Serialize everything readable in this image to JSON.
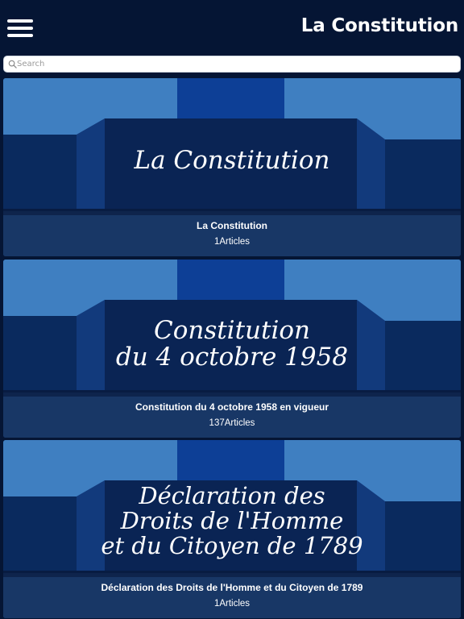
{
  "header": {
    "title": "La Constitution",
    "menu_icon": "hamburger-menu-icon"
  },
  "search": {
    "placeholder": "Search",
    "value": "",
    "icon": "search-icon"
  },
  "colors": {
    "header_bg": "#051534",
    "banner_light": "#3f7fc1",
    "banner_center": "#0a2a62",
    "banner_stripe": "#0d3f96"
  },
  "cards": [
    {
      "banner_lines": [
        "La Constitution"
      ],
      "name": "La Constitution",
      "count": "1Articles"
    },
    {
      "banner_lines": [
        "Constitution",
        "du 4 octobre 1958"
      ],
      "name": "Constitution du 4 octobre 1958 en vigueur",
      "count": "137Articles"
    },
    {
      "banner_lines": [
        "Déclaration des",
        "Droits de l'Homme",
        "et du Citoyen de 1789"
      ],
      "name": "Déclaration des Droits de l'Homme et du Citoyen de 1789",
      "count": "1Articles"
    }
  ]
}
